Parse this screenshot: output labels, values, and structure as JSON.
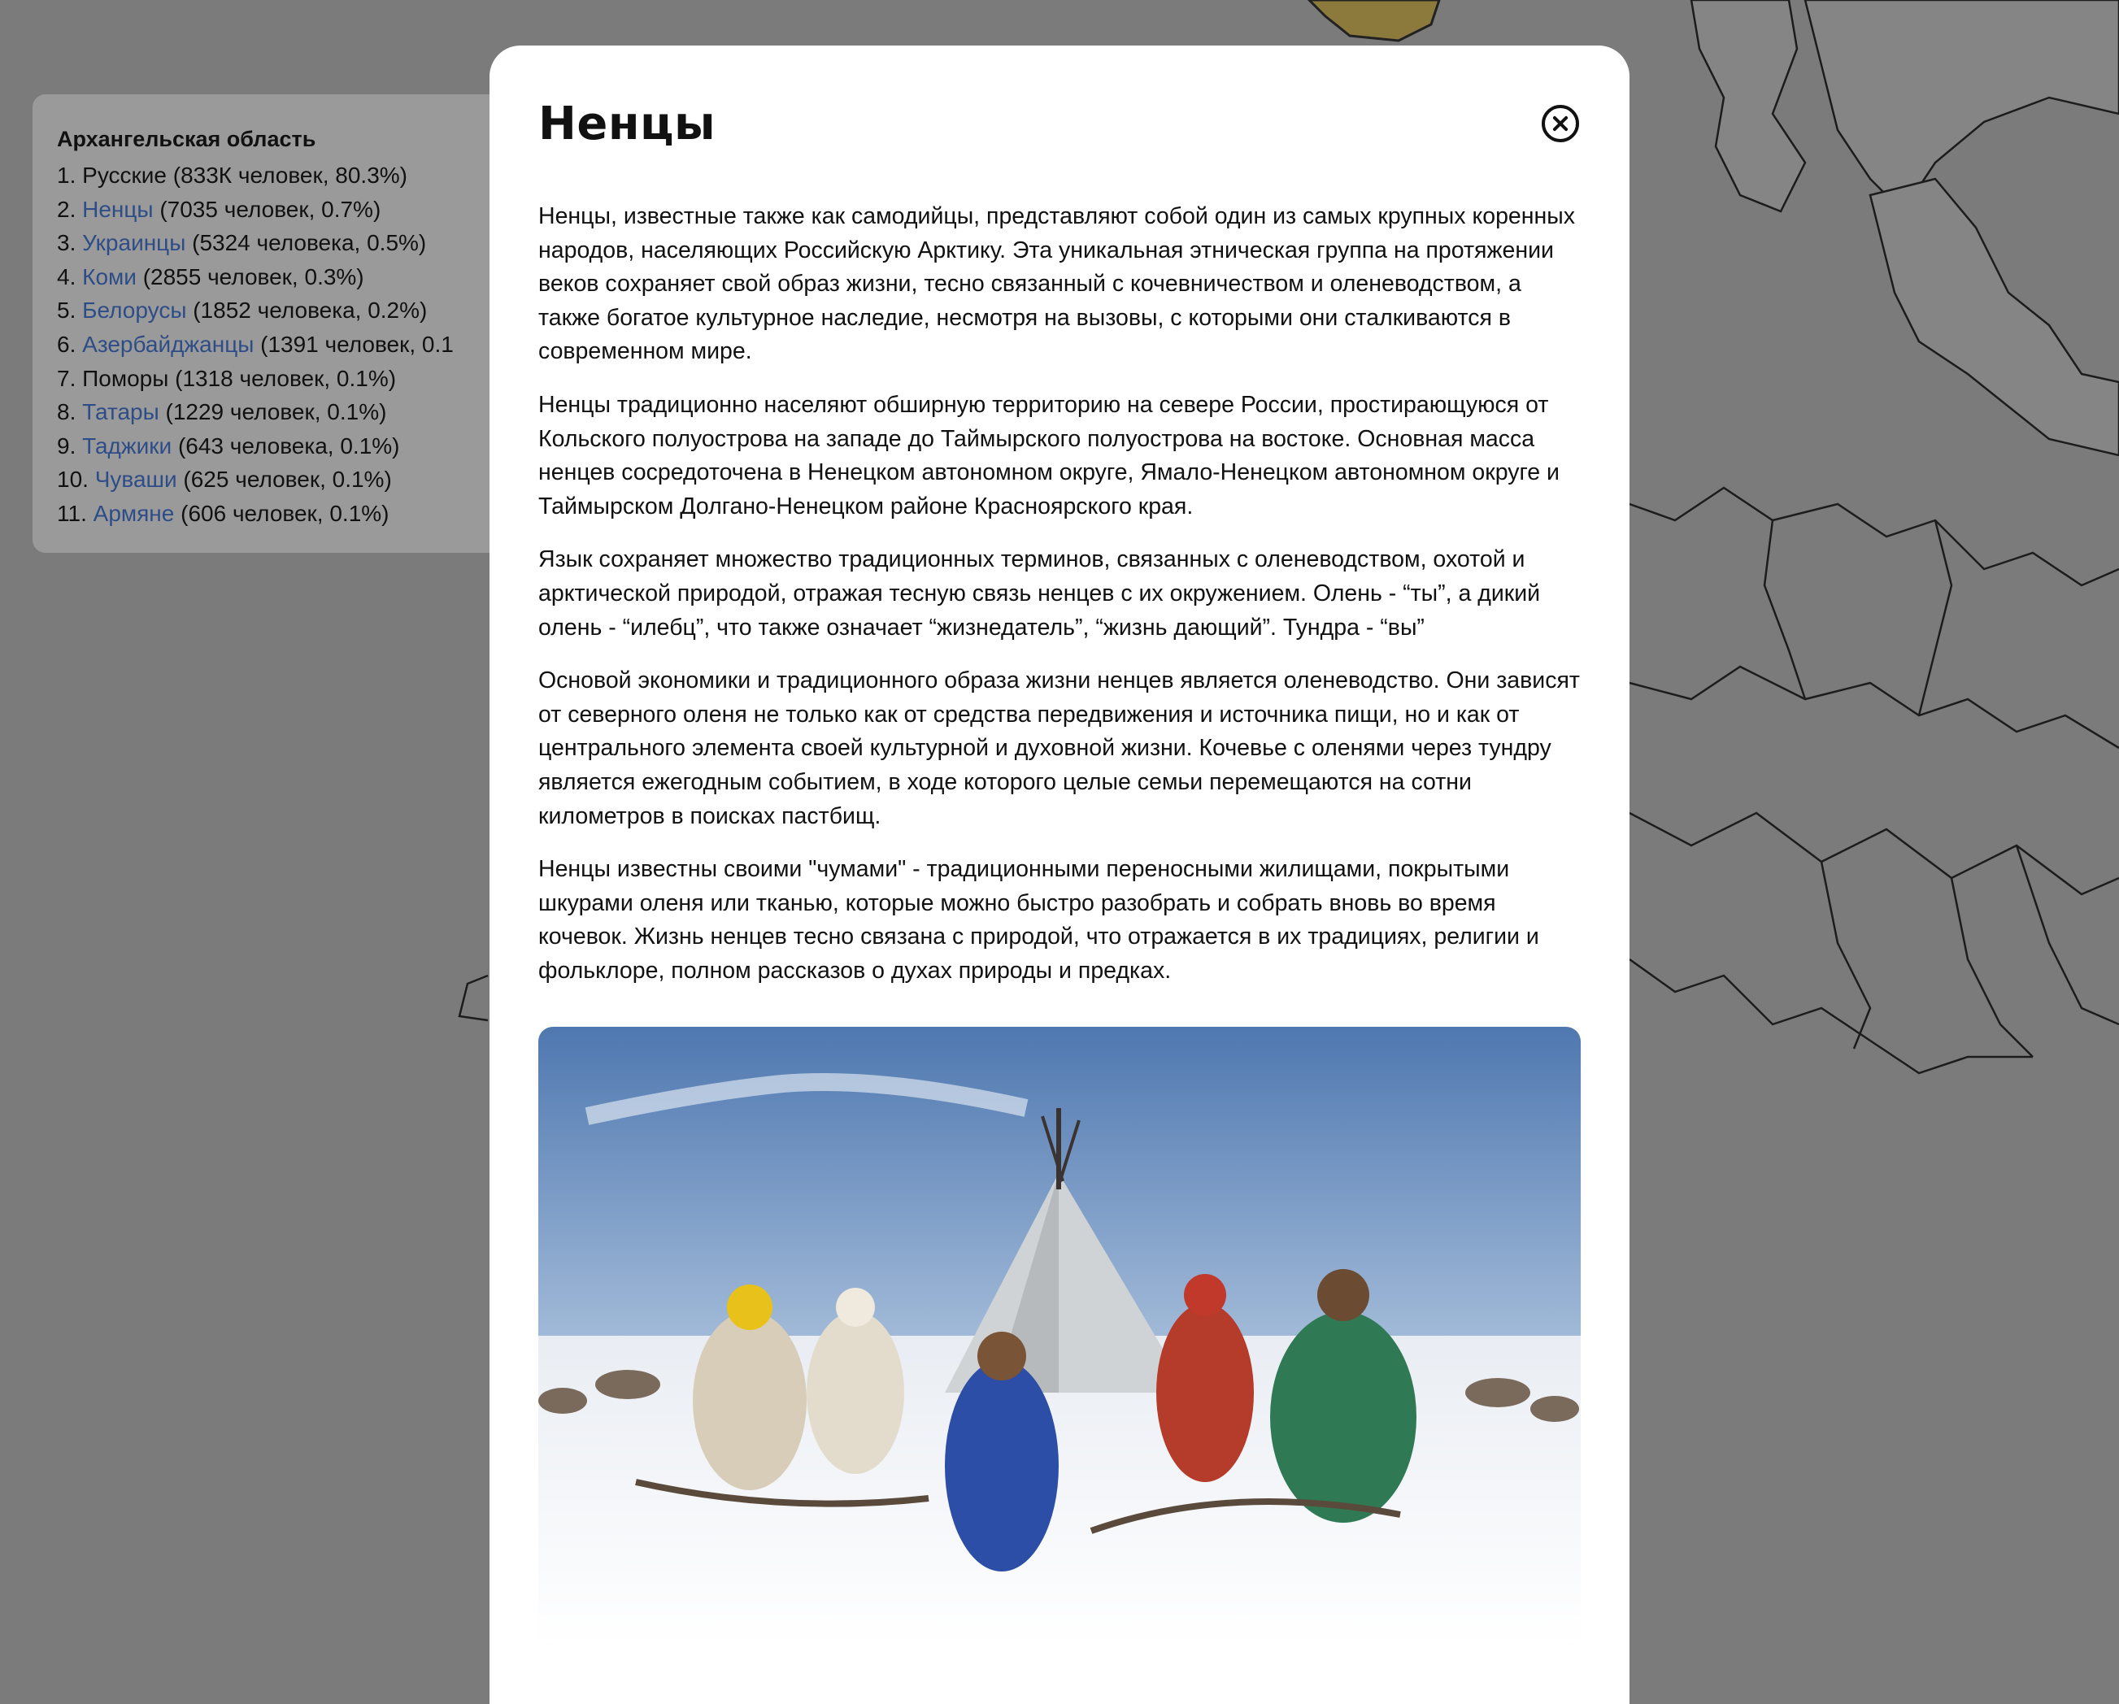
{
  "panel": {
    "title": "Архангельская область",
    "items": [
      {
        "num": "1.",
        "name": "Русские",
        "link": false,
        "detail": " (833К человек, 80.3%)"
      },
      {
        "num": "2.",
        "name": "Ненцы",
        "link": true,
        "detail": " (7035 человек, 0.7%)"
      },
      {
        "num": "3.",
        "name": "Украинцы",
        "link": true,
        "detail": " (5324 человека, 0.5%)"
      },
      {
        "num": "4.",
        "name": "Коми",
        "link": true,
        "detail": " (2855 человек, 0.3%)"
      },
      {
        "num": "5.",
        "name": "Белорусы",
        "link": true,
        "detail": " (1852 человека, 0.2%)"
      },
      {
        "num": "6.",
        "name": "Азербайджанцы",
        "link": true,
        "detail": " (1391 человек, 0.1"
      },
      {
        "num": "7.",
        "name": "Поморы",
        "link": false,
        "detail": " (1318 человек, 0.1%)"
      },
      {
        "num": "8.",
        "name": "Татары",
        "link": true,
        "detail": " (1229 человек, 0.1%)"
      },
      {
        "num": "9.",
        "name": "Таджики",
        "link": true,
        "detail": " (643 человека, 0.1%)"
      },
      {
        "num": "10.",
        "name": "Чуваши",
        "link": true,
        "detail": " (625 человек, 0.1%)"
      },
      {
        "num": "11.",
        "name": "Армяне",
        "link": true,
        "detail": " (606 человек, 0.1%)"
      }
    ]
  },
  "modal": {
    "title": "Ненцы",
    "paragraphs": [
      "Ненцы, известные также как самодийцы, представляют собой один из самых крупных коренных народов, населяющих Российскую Арктику. Эта уникальная этническая группа на протяжении веков сохраняет свой образ жизни, тесно связанный с кочевничеством и оленеводством, а также богатое культурное наследие, несмотря на вызовы, с которыми они сталкиваются в современном мире.",
      "Ненцы традиционно населяют обширную территорию на севере России, простирающуюся от Кольского полуострова на западе до Таймырского полуострова на востоке. Основная масса ненцев сосредоточена в Ненецком автономном округе, Ямало-Ненецком автономном округе и Таймырском Долгано-Ненецком районе Красноярского края.",
      "Язык сохраняет множество традиционных терминов, связанных с оленеводством, охотой и арктической природой, отражая тесную связь ненцев с их окружением. Олень - “ты”, а дикий олень - “илебц”, что также означает “жизнедатель”, “жизнь дающий”. Тундра - “вы”",
      "Основой экономики и традиционного образа жизни ненцев является оленеводство. Они зависят от северного оленя не только как от средства передвижения и источника пищи, но и как от центрального элемента своей культурной и духовной жизни. Кочевье с оленями через тундру является ежегодным событием, в ходе которого целые семьи перемещаются на сотни километров в поисках пастбищ.",
      "Ненцы известны своими \"чумами\" - традиционными переносными жилищами, покрытыми шкурами оленя или тканью, которые можно быстро разобрать и собрать вновь во время кочевок. Жизнь ненцев тесно связана с природой, что отражается в их традициях, религии и фольклоре, полном рассказов о духах природы и предках."
    ]
  },
  "colors": {
    "overlay": "#7b7b7b",
    "highlight_region": "#8c7a3c",
    "panel_bg": "#9a9a9a",
    "link": "#2e4d87"
  }
}
